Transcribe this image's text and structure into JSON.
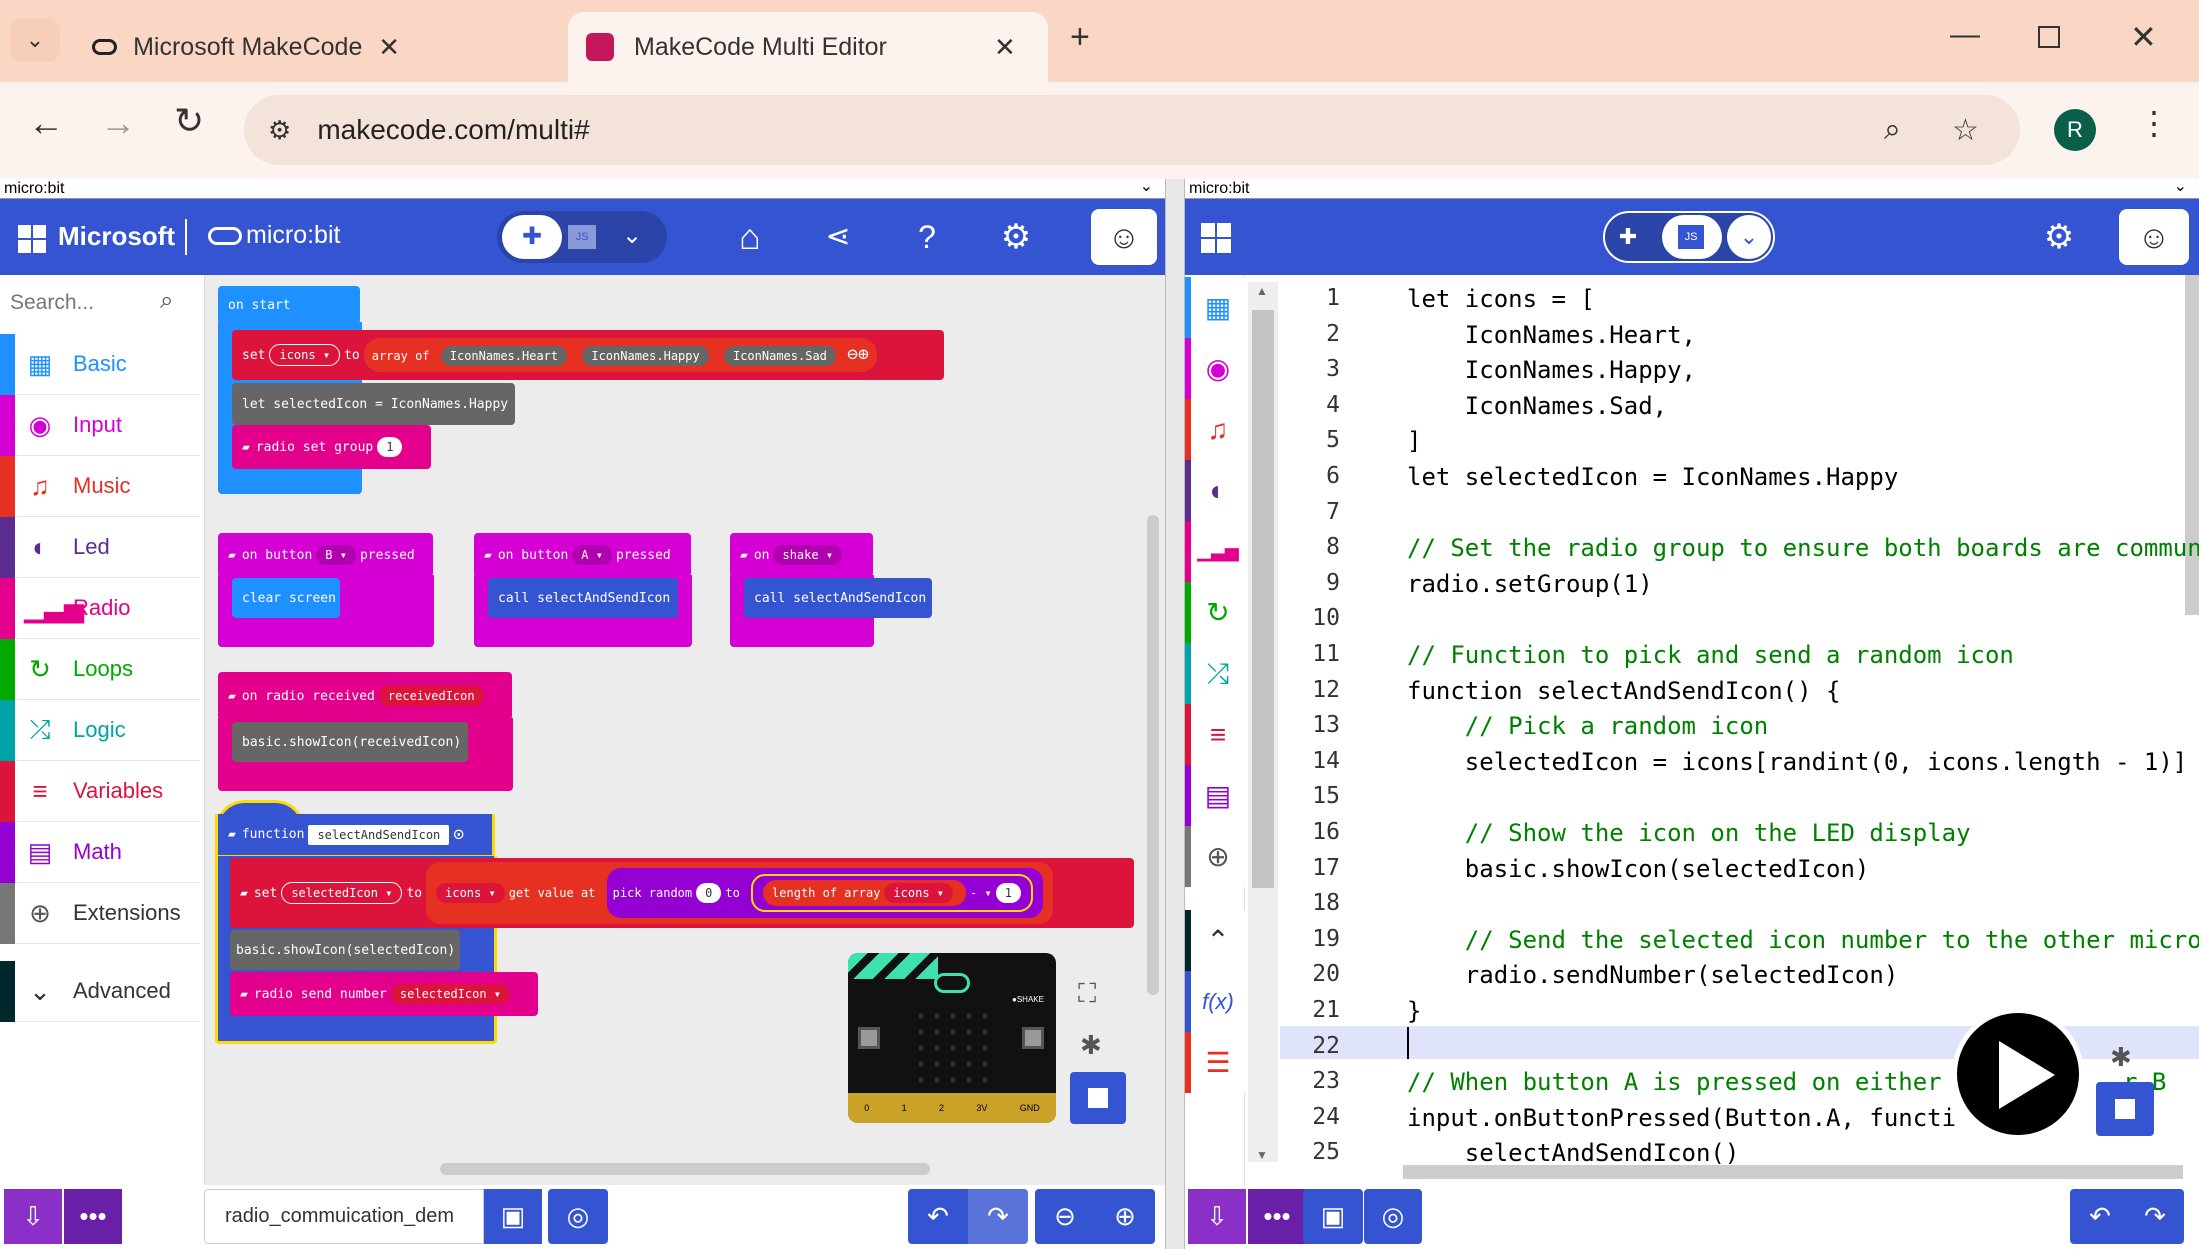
{
  "browser": {
    "tabs": [
      {
        "title": "Microsoft MakeCode for micro:"
      },
      {
        "title": "MakeCode Multi Editor"
      }
    ],
    "url": "makecode.com/multi#",
    "profile_initial": "R"
  },
  "left": {
    "selector": "micro:bit",
    "brand": "Microsoft",
    "product": "micro:bit",
    "search_placeholder": "Search...",
    "categories": [
      {
        "label": "Basic",
        "color": "#1e90ff"
      },
      {
        "label": "Input",
        "color": "#d400d4"
      },
      {
        "label": "Music",
        "color": "#e63022"
      },
      {
        "label": "Led",
        "color": "#5c2d91"
      },
      {
        "label": "Radio",
        "color": "#e3008c"
      },
      {
        "label": "Loops",
        "color": "#00aa00"
      },
      {
        "label": "Logic",
        "color": "#00a4a6"
      },
      {
        "label": "Variables",
        "color": "#dc143c"
      },
      {
        "label": "Math",
        "color": "#9400d3"
      },
      {
        "label": "Extensions",
        "color": "#777777"
      },
      {
        "label": "Advanced",
        "color": "#00272b"
      }
    ],
    "blocks": {
      "on_start": "on start",
      "set": "set",
      "icons": "icons ▾",
      "to": "to",
      "array_of": "array of",
      "heart": "IconNames.Heart",
      "happy": "IconNames.Happy",
      "sad": "IconNames.Sad",
      "let_selected": "let selectedIcon = IconNames.Happy",
      "radio_set_group": "radio set group",
      "group_val": "1",
      "on_button": "on button",
      "b": "B ▾",
      "a": "A ▾",
      "pressed": "pressed",
      "clear_screen": "clear screen",
      "call_send": "call selectAndSendIcon",
      "on": "on",
      "shake": "shake ▾",
      "on_radio_received": "on radio received",
      "received_icon": "receivedIcon",
      "show_received": "basic.showIcon(receivedIcon)",
      "function": "function",
      "fn_name": "selectAndSendIcon",
      "selected_icon": "selectedIcon ▾",
      "get_value_at": "get value at",
      "pick_random": "pick random",
      "zero": "0",
      "length_of_array": "length of array",
      "minus": "- ▾",
      "one": "1",
      "show_selected": "basic.showIcon(selectedIcon)",
      "radio_send_number": "radio send number",
      "selected_icon2": "selectedIcon ▾"
    },
    "sim": {
      "shake": "SHAKE",
      "pins": [
        "0",
        "1",
        "2",
        "3V",
        "GND"
      ]
    },
    "project_name": "radio_commuication_dem"
  },
  "right": {
    "selector": "micro:bit",
    "lines": [
      "let icons = [",
      "    IconNames.Heart,",
      "    IconNames.Happy,",
      "    IconNames.Sad,",
      "]",
      "let selectedIcon = IconNames.Happy",
      "",
      "// Set the radio group to ensure both boards are commun",
      "radio.setGroup(1)",
      "",
      "// Function to pick and send a random icon",
      "function selectAndSendIcon() {",
      "    // Pick a random icon",
      "    selectedIcon = icons[randint(0, icons.length - 1)]",
      "",
      "    // Show the icon on the LED display",
      "    basic.showIcon(selectedIcon)",
      "",
      "    // Send the selected icon number to the other micro",
      "    radio.sendNumber(selectedIcon)",
      "}",
      "",
      "// When button A is pressed on either",
      "input.onButtonPressed(Button.A, functi",
      "    selectAndSendIcon()"
    ],
    "line_numbers": [
      "1",
      "2",
      "3",
      "4",
      "5",
      "6",
      "7",
      "8",
      "9",
      "10",
      "11",
      "12",
      "13",
      "14",
      "15",
      "16",
      "17",
      "18",
      "19",
      "20",
      "21",
      "22",
      "23",
      "24",
      "25"
    ],
    "code_suffix_23": "r B",
    "code_suffix_24": "() {"
  }
}
